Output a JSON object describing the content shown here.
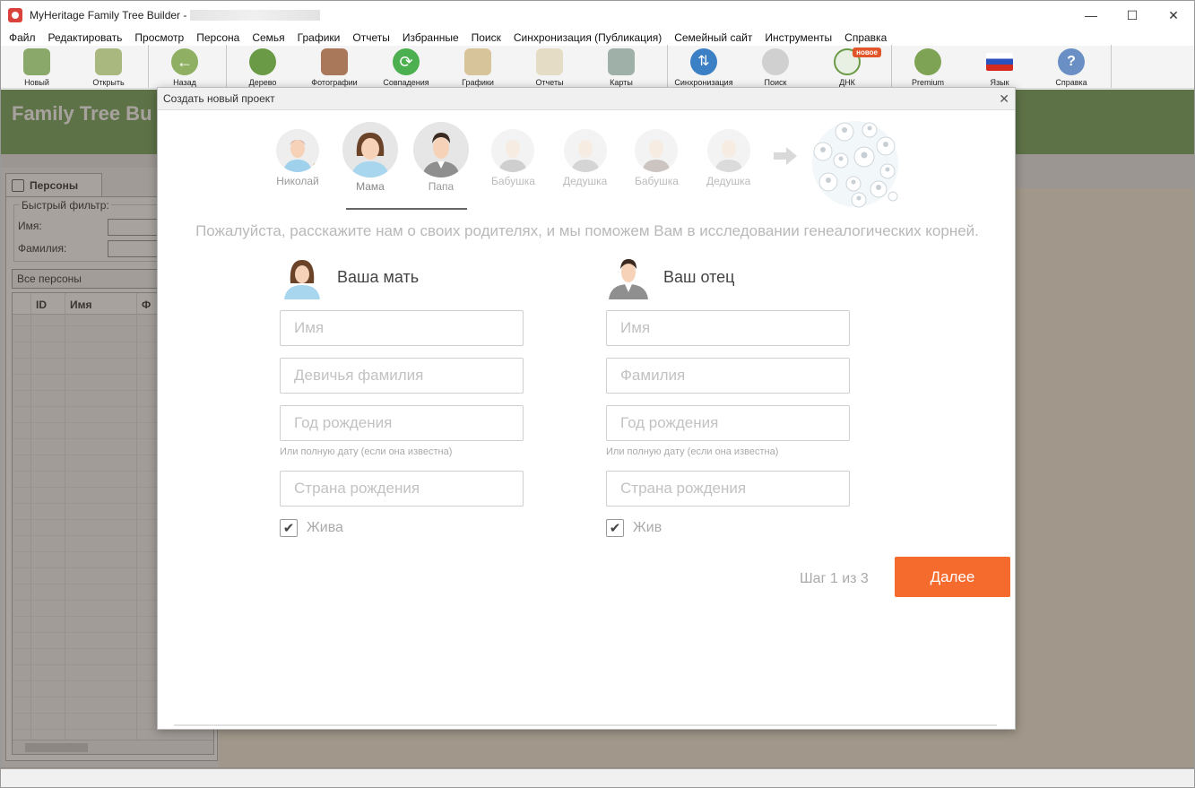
{
  "window": {
    "title": "MyHeritage Family Tree Builder -",
    "controls": {
      "minimize": "—",
      "maximize": "☐",
      "close": "✕"
    }
  },
  "menu": [
    "Файл",
    "Редактировать",
    "Просмотр",
    "Персона",
    "Семья",
    "Графики",
    "Отчеты",
    "Избранные",
    "Поиск",
    "Синхронизация (Публикация)",
    "Семейный сайт",
    "Инструменты",
    "Справка"
  ],
  "toolbar": {
    "new": "Новый",
    "open": "Открыть",
    "back": "Назад",
    "tree": "Дерево",
    "photos": "Фотографии",
    "matches": "Совпадения",
    "charts": "Графики",
    "reports": "Отчеты",
    "maps": "Карты",
    "sync": "Синхронизация",
    "search": "Поиск",
    "dna": "ДНК",
    "dna_badge": "новое",
    "premium": "Premium",
    "language": "Язык",
    "help": "Справка"
  },
  "banner": {
    "title": "Family Tree Bu"
  },
  "left_panel": {
    "tab": "Персоны",
    "quick_filter": "Быстрый фильтр:",
    "first_name_label": "Имя:",
    "last_name_label": "Фамилия:",
    "combo": "Все персоны",
    "columns": [
      "ID",
      "Имя",
      "Ф"
    ]
  },
  "dialog": {
    "title": "Создать новый проект",
    "close": "✕",
    "steps": [
      {
        "label": "Николай"
      },
      {
        "label": "Мама"
      },
      {
        "label": "Папа"
      },
      {
        "label": "Бабушка"
      },
      {
        "label": "Дедушка"
      },
      {
        "label": "Бабушка"
      },
      {
        "label": "Дедушка"
      }
    ],
    "intro": "Пожалуйста, расскажите нам о своих родителях, и мы поможем Вам в исследовании генеалогических корней.",
    "mother": {
      "title": "Ваша мать",
      "first_name_placeholder": "Имя",
      "maiden_name_placeholder": "Девичья фамилия",
      "birth_year_placeholder": "Год рождения",
      "hint": "Или полную дату (если она известна)",
      "birth_country_placeholder": "Страна рождения",
      "alive_label": "Жива",
      "alive_checked": true
    },
    "father": {
      "title": "Ваш отец",
      "first_name_placeholder": "Имя",
      "last_name_placeholder": "Фамилия",
      "birth_year_placeholder": "Год рождения",
      "hint": "Или полную дату (если она известна)",
      "birth_country_placeholder": "Страна рождения",
      "alive_label": "Жив",
      "alive_checked": true
    },
    "step_count": "Шаг 1 из 3",
    "next_button": "Далее",
    "check_glyph": "✔"
  },
  "colors": {
    "accent": "#f56a2d",
    "banner": "#6d9f52",
    "step_check": "#d6a24d"
  }
}
